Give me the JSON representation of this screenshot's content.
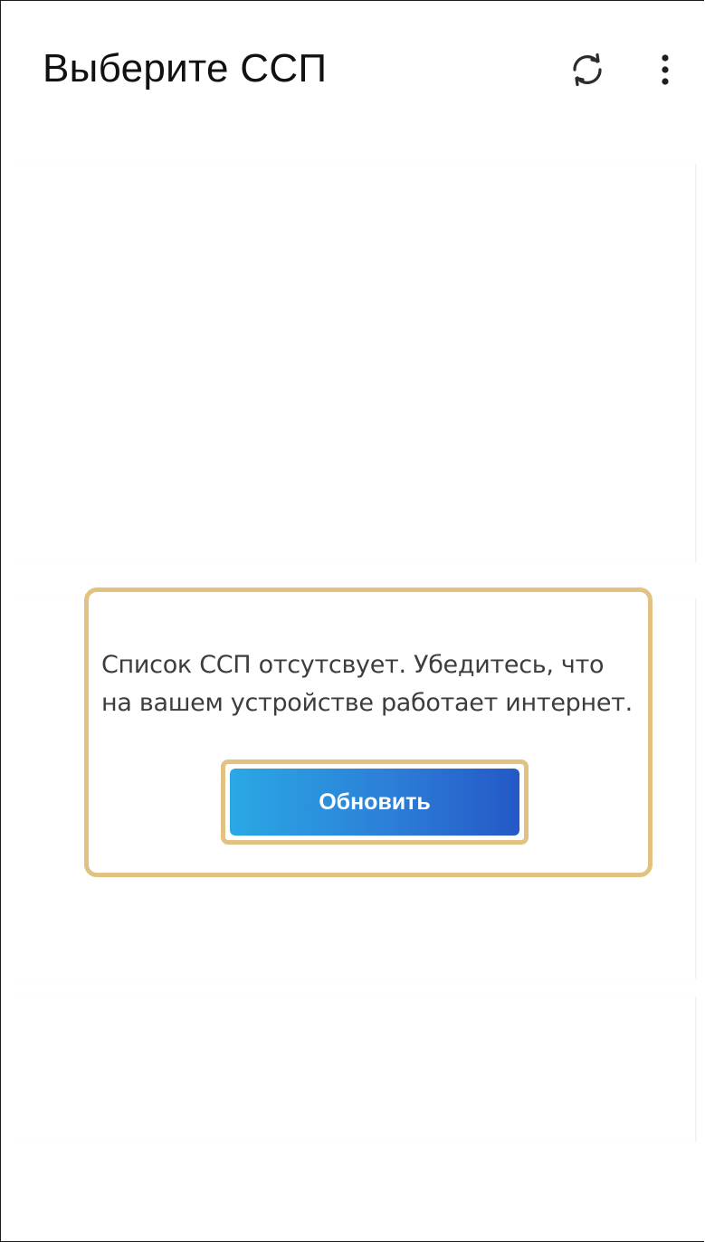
{
  "header": {
    "title": "Выберите ССП",
    "refresh_icon": "refresh-icon",
    "more_icon": "more-vertical-icon"
  },
  "dialog": {
    "message": "Список ССП отсутсвует. Убедитесь, что\nна вашем устройстве работает интернет.",
    "refresh_button_label": "Обновить"
  },
  "colors": {
    "highlight_border": "#e2c283",
    "button_gradient_start": "#2aa8e4",
    "button_gradient_end": "#2458c6",
    "title_text": "#111111",
    "message_text": "#3d3d3d"
  }
}
